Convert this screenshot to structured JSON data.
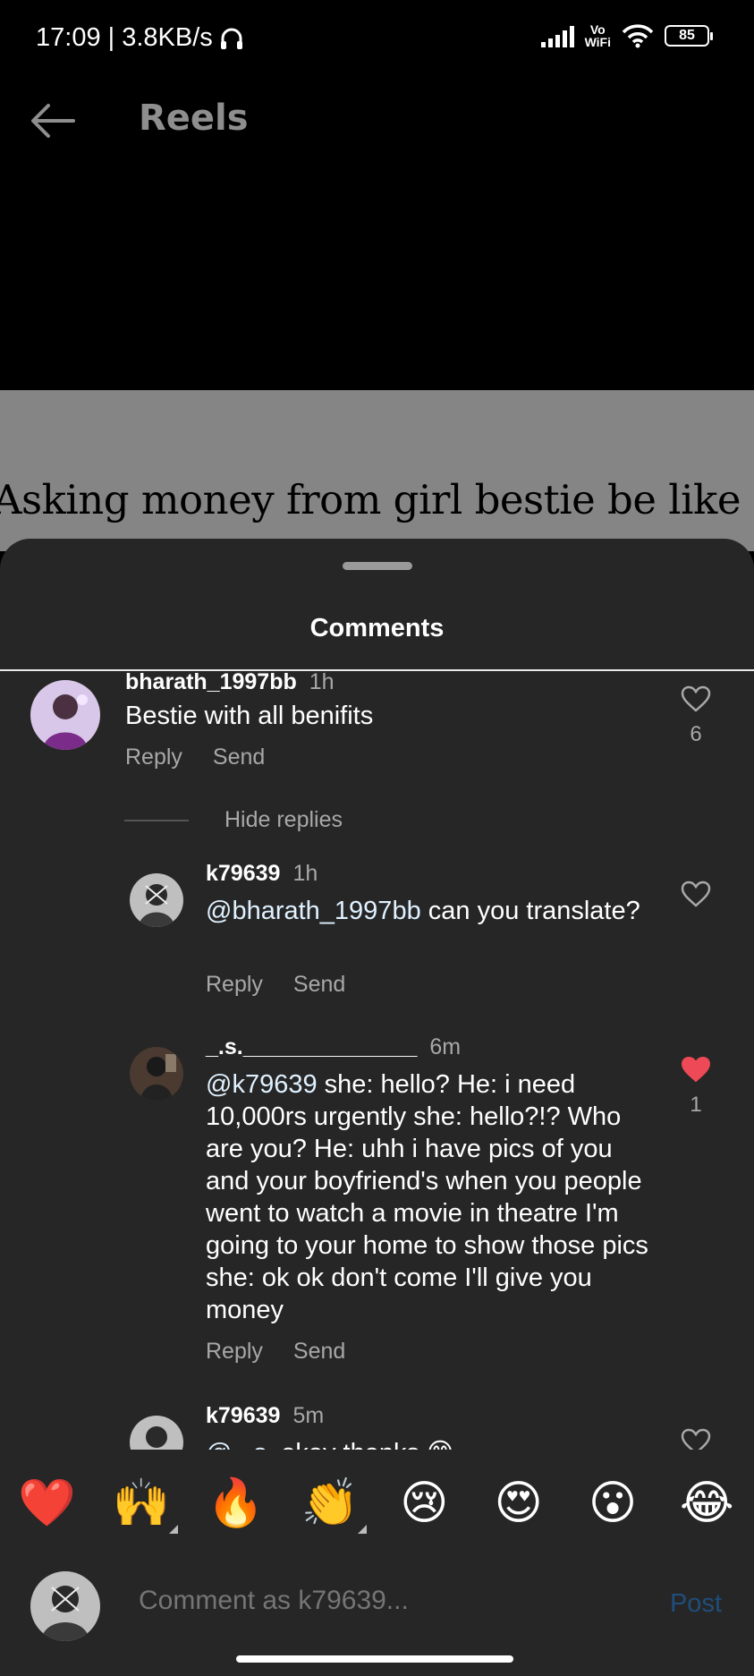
{
  "status_bar": {
    "time": "17:09 | 3.8KB/s",
    "network": "Vo\nWiFi",
    "battery": "85"
  },
  "header": {
    "title": "Reels"
  },
  "video": {
    "caption": "Asking money from girl bestie be like"
  },
  "sheet": {
    "title": "Comments"
  },
  "comments": [
    {
      "username": "bharath_1997bb",
      "time": "1h",
      "text": "Bestie with all benifits",
      "reply_label": "Reply",
      "send_label": "Send",
      "likes": "6",
      "liked": false
    }
  ],
  "hide_replies_label": "Hide replies",
  "replies": [
    {
      "username": "k79639",
      "time": "1h",
      "mention": "@bharath_1997bb",
      "text": " can you translate?",
      "reply_label": "Reply",
      "send_label": "Send",
      "likes": "",
      "liked": false
    },
    {
      "username": "_.s.______________",
      "time": "6m",
      "mention": "@k79639",
      "text": " she: hello?  He: i need 10,000rs urgently  she: hello?!? Who are you?  He: uhh i have pics of you and your boyfriend's when you people went to watch a movie in theatre I'm going to your home to show those pics  she: ok ok don't come I'll give you money",
      "reply_label": "Reply",
      "send_label": "Send",
      "likes": "1",
      "liked": true
    },
    {
      "username": "k79639",
      "time": "5m",
      "mention": "@_.s.",
      "text": " okay thanks 😊",
      "likes": "",
      "liked": false
    }
  ],
  "reactions": [
    "❤️",
    "🙌",
    "🔥",
    "👏",
    "😢",
    "😍",
    "😮",
    "😂"
  ],
  "composer": {
    "placeholder": "Comment as k79639...",
    "post_label": "Post"
  },
  "colors": {
    "sheet_bg": "#262626",
    "secondary_text": "#a8a8a8",
    "like_red": "#ed4956",
    "post_blue": "#1f4e7a"
  }
}
